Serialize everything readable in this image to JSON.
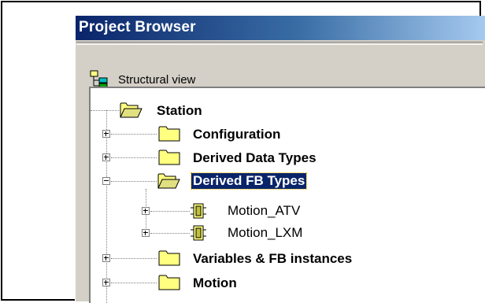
{
  "window": {
    "title": "Project Browser"
  },
  "toolbar": {
    "view_label": "Structural view",
    "view_icon": "structural-view-icon"
  },
  "tree": {
    "root": {
      "label": "Station",
      "icon": "folder-open-icon",
      "expanded": true
    },
    "children": [
      {
        "label": "Configuration",
        "icon": "folder-icon",
        "expanded": false
      },
      {
        "label": "Derived Data Types",
        "icon": "folder-icon",
        "expanded": false
      },
      {
        "label": "Derived FB Types",
        "icon": "folder-open-icon",
        "expanded": true,
        "selected": true,
        "children": [
          {
            "label": "Motion_ATV",
            "icon": "function-block-icon",
            "expanded": false
          },
          {
            "label": "Motion_LXM",
            "icon": "function-block-icon",
            "expanded": false
          }
        ]
      },
      {
        "label": "Variables & FB instances",
        "icon": "folder-icon",
        "expanded": false
      },
      {
        "label": "Motion",
        "icon": "folder-icon",
        "expanded": false
      }
    ]
  },
  "colors": {
    "titlebar_start": "#0a246a",
    "titlebar_end": "#a6caf0",
    "selection": "#0a246a",
    "folder": "#ffff80"
  }
}
